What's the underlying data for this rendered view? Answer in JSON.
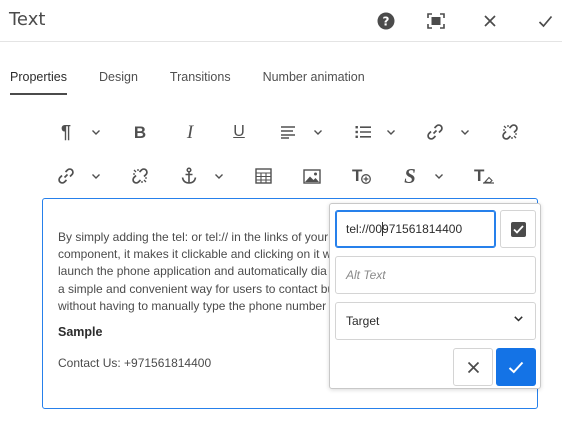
{
  "header": {
    "title": "Text",
    "help_icon": "help-circle-icon",
    "fullscreen_icon": "fullscreen-icon",
    "close_icon": "close-icon",
    "done_icon": "checkmark-icon"
  },
  "tabs": [
    {
      "label": "Properties",
      "active": true
    },
    {
      "label": "Design",
      "active": false
    },
    {
      "label": "Transitions",
      "active": false
    },
    {
      "label": "Number animation",
      "active": false
    }
  ],
  "toolbar_row1": [
    {
      "icon": "paragraph-icon",
      "dropdown": true
    },
    {
      "icon": "bold-icon",
      "dropdown": false
    },
    {
      "icon": "italic-icon",
      "dropdown": false
    },
    {
      "icon": "underline-icon",
      "dropdown": false
    },
    {
      "icon": "justify-icon",
      "dropdown": true
    },
    {
      "icon": "list-icon",
      "dropdown": true
    },
    {
      "icon": "link-icon",
      "dropdown": true
    },
    {
      "icon": "unlink-icon",
      "dropdown": false
    }
  ],
  "toolbar_row2": [
    {
      "icon": "link-icon",
      "dropdown": true
    },
    {
      "icon": "unlink-icon",
      "dropdown": false
    },
    {
      "icon": "anchor-icon",
      "dropdown": true
    },
    {
      "icon": "table-icon",
      "dropdown": false
    },
    {
      "icon": "image-icon",
      "dropdown": false
    },
    {
      "icon": "text-add-icon",
      "dropdown": false
    },
    {
      "icon": "special-char-icon",
      "dropdown": true
    },
    {
      "icon": "text-clear-icon",
      "dropdown": false
    }
  ],
  "glyphs": {
    "paragraph": "¶",
    "bold": "B",
    "italic": "I",
    "underline": "U",
    "special": "S",
    "text_add": "T",
    "text_clear": "T"
  },
  "editor": {
    "line1": "By simply adding the tel: or tel:// in the links of your",
    "line2": "component, it makes it clickable and clicking on it w",
    "line3": "launch the phone application and automatically dia",
    "line4": "a simple and convenient way for users to contact bu",
    "line5": "without having to manually type the phone number",
    "sample_heading": "Sample",
    "contact_line": "Contact Us: +971561814400"
  },
  "link_dialog": {
    "url_before_caret": "tel://00",
    "url_after_caret": "971561814400",
    "alt_text_placeholder": "Alt Text",
    "target_label": "Target",
    "checkbox_checked": true,
    "cancel_icon": "close-icon",
    "confirm_icon": "checkmark-icon"
  },
  "colors": {
    "accent": "#1473e6",
    "focus": "#2680eb",
    "icon": "#505050"
  }
}
